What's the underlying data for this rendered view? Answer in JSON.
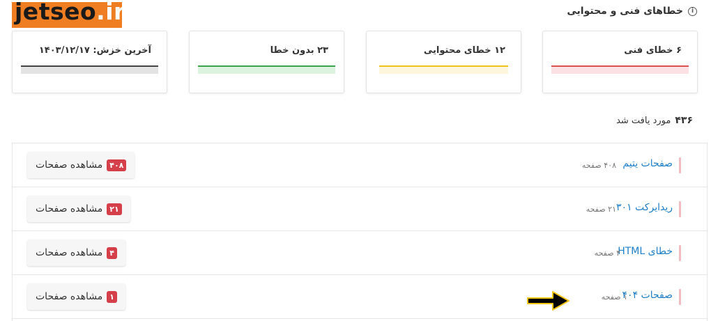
{
  "logo": {
    "text": "jetseo",
    "suffix": ".ir"
  },
  "header": {
    "title": "خطاهای فنی و محتوایی",
    "info_icon": "info-circle-icon"
  },
  "stats": [
    {
      "label": "۶ خطای فنی",
      "color": "#d9534f"
    },
    {
      "label": "۱۲ خطای محتوایی",
      "color": "#f0c419"
    },
    {
      "label": "۲۳ بدون خطا",
      "color": "#3ca44a"
    },
    {
      "label": "آخرین خزش: ۱۴۰۳/۱۲/۱۷",
      "color": "#444444"
    }
  ],
  "found": {
    "count": "۴۳۶",
    "label": "مورد یافت شد"
  },
  "rows": [
    {
      "title": "صفحات یتیم",
      "sub": "۴۰۸ صفحه",
      "button": "مشاهده صفحات",
      "badge": "۴۰۸"
    },
    {
      "title": "ریدایرکت ۳۰۱",
      "sub": "۲۱ صفحه",
      "button": "مشاهده صفحات",
      "badge": "۲۱"
    },
    {
      "title": "خطای HTML",
      "sub": "۴ صفحه",
      "button": "مشاهده صفحات",
      "badge": "۴"
    },
    {
      "title": "صفحات ۴۰۴",
      "sub": "۱ صفحه",
      "button": "مشاهده صفحات",
      "badge": "۱"
    }
  ],
  "annotation": {
    "icon": "arrow-right-icon",
    "color": "#000000",
    "outline": "#f5c518"
  }
}
